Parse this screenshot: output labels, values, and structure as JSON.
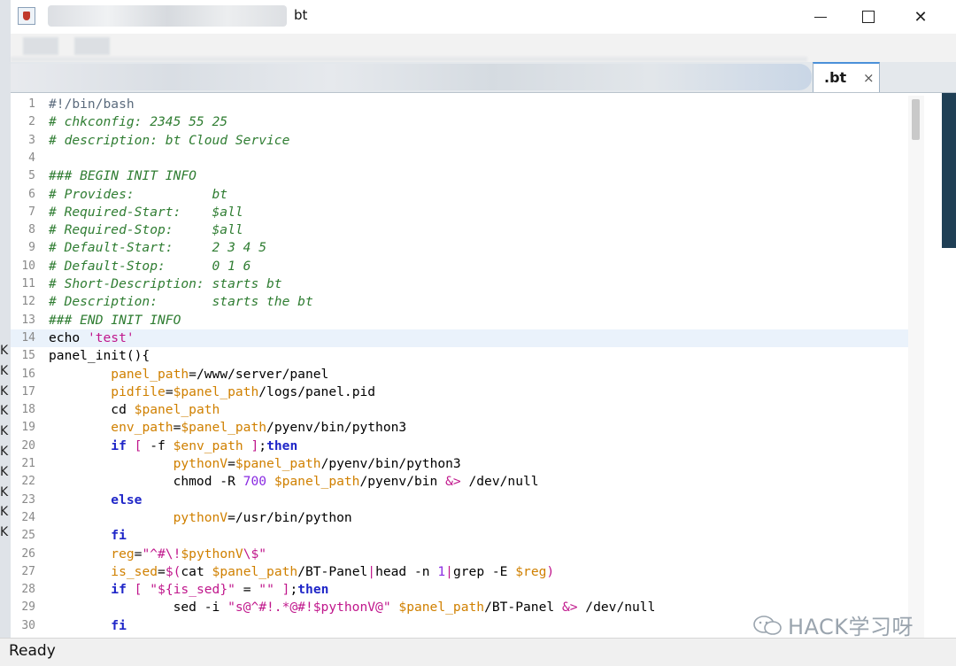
{
  "window": {
    "title_suffix": "bt",
    "minimize_icon": "minimize-icon",
    "maximize_icon": "maximize-icon",
    "close_glyph": "✕"
  },
  "tab": {
    "label": ".bt",
    "close_glyph": "×"
  },
  "background_letters": [
    "K",
    "K",
    "K",
    "K",
    "K",
    "K",
    "K",
    "K",
    "K",
    "K"
  ],
  "status": {
    "text": "Ready"
  },
  "watermark": {
    "text": "HACK学习呀"
  },
  "colors": {
    "comment": "#2f7d32",
    "string": "#c0178c",
    "variable": "#d08000",
    "keyword": "#1f26c8",
    "number": "#8a2be2",
    "current_line": "#eaf2fb"
  },
  "editor": {
    "current_line": 14,
    "lines": [
      {
        "n": "1",
        "segs": [
          [
            "g",
            "#!/bin/bash"
          ]
        ]
      },
      {
        "n": "2",
        "segs": [
          [
            "c",
            "# chkconfig: 2345 55 25"
          ]
        ]
      },
      {
        "n": "3",
        "segs": [
          [
            "c",
            "# description: bt Cloud Service"
          ]
        ]
      },
      {
        "n": "4",
        "segs": []
      },
      {
        "n": "5",
        "segs": [
          [
            "c",
            "### BEGIN INIT INFO"
          ]
        ]
      },
      {
        "n": "6",
        "segs": [
          [
            "c",
            "# Provides:          bt"
          ]
        ]
      },
      {
        "n": "7",
        "segs": [
          [
            "c",
            "# Required-Start:    $all"
          ]
        ]
      },
      {
        "n": "8",
        "segs": [
          [
            "c",
            "# Required-Stop:     $all"
          ]
        ]
      },
      {
        "n": "9",
        "segs": [
          [
            "c",
            "# Default-Start:     2 3 4 5"
          ]
        ]
      },
      {
        "n": "10",
        "segs": [
          [
            "c",
            "# Default-Stop:      0 1 6"
          ]
        ]
      },
      {
        "n": "11",
        "segs": [
          [
            "c",
            "# Short-Description: starts bt"
          ]
        ]
      },
      {
        "n": "12",
        "segs": [
          [
            "c",
            "# Description:       starts the bt"
          ]
        ]
      },
      {
        "n": "13",
        "segs": [
          [
            "c",
            "### END INIT INFO"
          ]
        ]
      },
      {
        "n": "14",
        "segs": [
          [
            "p",
            "echo "
          ],
          [
            "s",
            "'test'"
          ]
        ]
      },
      {
        "n": "15",
        "segs": [
          [
            "p",
            "panel_init(){"
          ]
        ]
      },
      {
        "n": "16",
        "segs": [
          [
            "p",
            "        "
          ],
          [
            "v",
            "panel_path"
          ],
          [
            "p",
            "=/www/server/panel"
          ]
        ]
      },
      {
        "n": "17",
        "segs": [
          [
            "p",
            "        "
          ],
          [
            "v",
            "pidfile"
          ],
          [
            "p",
            "="
          ],
          [
            "v",
            "$panel_path"
          ],
          [
            "p",
            "/logs/panel.pid"
          ]
        ]
      },
      {
        "n": "18",
        "segs": [
          [
            "p",
            "        cd "
          ],
          [
            "v",
            "$panel_path"
          ]
        ]
      },
      {
        "n": "19",
        "segs": [
          [
            "p",
            "        "
          ],
          [
            "v",
            "env_path"
          ],
          [
            "p",
            "="
          ],
          [
            "v",
            "$panel_path"
          ],
          [
            "p",
            "/pyenv/bin/python3"
          ]
        ]
      },
      {
        "n": "20",
        "segs": [
          [
            "p",
            "        "
          ],
          [
            "k",
            "if"
          ],
          [
            "p",
            " "
          ],
          [
            "s",
            "["
          ],
          [
            "p",
            " -f "
          ],
          [
            "v",
            "$env_path"
          ],
          [
            "p",
            " "
          ],
          [
            "s",
            "]"
          ],
          [
            "p",
            ";"
          ],
          [
            "k",
            "then"
          ]
        ]
      },
      {
        "n": "21",
        "segs": [
          [
            "p",
            "                "
          ],
          [
            "v",
            "pythonV"
          ],
          [
            "p",
            "="
          ],
          [
            "v",
            "$panel_path"
          ],
          [
            "p",
            "/pyenv/bin/python3"
          ]
        ]
      },
      {
        "n": "22",
        "segs": [
          [
            "p",
            "                chmod -R "
          ],
          [
            "n",
            "700"
          ],
          [
            "p",
            " "
          ],
          [
            "v",
            "$panel_path"
          ],
          [
            "p",
            "/pyenv/bin "
          ],
          [
            "s",
            "&>"
          ],
          [
            "p",
            " /dev/null"
          ]
        ]
      },
      {
        "n": "23",
        "segs": [
          [
            "p",
            "        "
          ],
          [
            "k",
            "else"
          ]
        ]
      },
      {
        "n": "24",
        "segs": [
          [
            "p",
            "                "
          ],
          [
            "v",
            "pythonV"
          ],
          [
            "p",
            "=/usr/bin/python"
          ]
        ]
      },
      {
        "n": "25",
        "segs": [
          [
            "p",
            "        "
          ],
          [
            "k",
            "fi"
          ]
        ]
      },
      {
        "n": "26",
        "segs": [
          [
            "p",
            "        "
          ],
          [
            "v",
            "reg"
          ],
          [
            "p",
            "="
          ],
          [
            "s",
            "\"^#\\!"
          ],
          [
            "v",
            "$pythonV"
          ],
          [
            "s",
            "\\$\""
          ]
        ]
      },
      {
        "n": "27",
        "segs": [
          [
            "p",
            "        "
          ],
          [
            "v",
            "is_sed"
          ],
          [
            "p",
            "="
          ],
          [
            "s",
            "$("
          ],
          [
            "p",
            "cat "
          ],
          [
            "v",
            "$panel_path"
          ],
          [
            "p",
            "/BT-Panel"
          ],
          [
            "s",
            "|"
          ],
          [
            "p",
            "head -n "
          ],
          [
            "n",
            "1"
          ],
          [
            "s",
            "|"
          ],
          [
            "p",
            "grep -E "
          ],
          [
            "v",
            "$reg"
          ],
          [
            "s",
            ")"
          ]
        ]
      },
      {
        "n": "28",
        "segs": [
          [
            "p",
            "        "
          ],
          [
            "k",
            "if"
          ],
          [
            "p",
            " "
          ],
          [
            "s",
            "["
          ],
          [
            "p",
            " "
          ],
          [
            "s",
            "\"${is_sed}\""
          ],
          [
            "p",
            " = "
          ],
          [
            "s",
            "\"\""
          ],
          [
            "p",
            " "
          ],
          [
            "s",
            "]"
          ],
          [
            "p",
            ";"
          ],
          [
            "k",
            "then"
          ]
        ]
      },
      {
        "n": "29",
        "segs": [
          [
            "p",
            "                sed -i "
          ],
          [
            "s",
            "\"s@^#!.*@#!$pythonV@\""
          ],
          [
            "p",
            " "
          ],
          [
            "v",
            "$panel_path"
          ],
          [
            "p",
            "/BT-Panel "
          ],
          [
            "s",
            "&>"
          ],
          [
            "p",
            " /dev/null"
          ]
        ]
      },
      {
        "n": "30",
        "segs": [
          [
            "p",
            "        "
          ],
          [
            "k",
            "fi"
          ]
        ]
      }
    ]
  }
}
